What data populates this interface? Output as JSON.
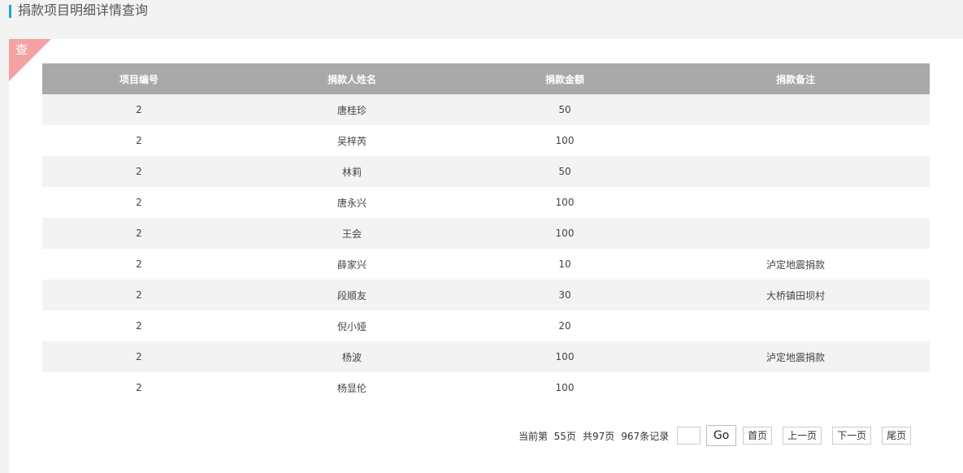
{
  "header": {
    "title": "捐款项目明细详情查询"
  },
  "panel": {
    "corner_label": "查"
  },
  "table": {
    "columns": [
      "项目编号",
      "捐款人姓名",
      "捐款金额",
      "捐款备注"
    ],
    "rows": [
      [
        "2",
        "唐桂珍",
        "50",
        ""
      ],
      [
        "2",
        "吴梓芮",
        "100",
        ""
      ],
      [
        "2",
        "林莉",
        "50",
        ""
      ],
      [
        "2",
        "唐永兴",
        "100",
        ""
      ],
      [
        "2",
        "王会",
        "100",
        ""
      ],
      [
        "2",
        "薛家兴",
        "10",
        "泸定地震捐款"
      ],
      [
        "2",
        "段顺友",
        "30",
        "大桥镇田坝村"
      ],
      [
        "2",
        "倪小娅",
        "20",
        ""
      ],
      [
        "2",
        "杨波",
        "100",
        "泸定地震捐款"
      ],
      [
        "2",
        "杨显伦",
        "100",
        ""
      ]
    ]
  },
  "pager": {
    "current_label": "当前第",
    "current_page": "55页",
    "total_pages": "共97页",
    "total_records": "967条记录",
    "page_input_value": "",
    "go_label": "Go",
    "first_label": "首页",
    "prev_label": "上一页",
    "next_label": "下一页",
    "last_label": "尾页"
  }
}
